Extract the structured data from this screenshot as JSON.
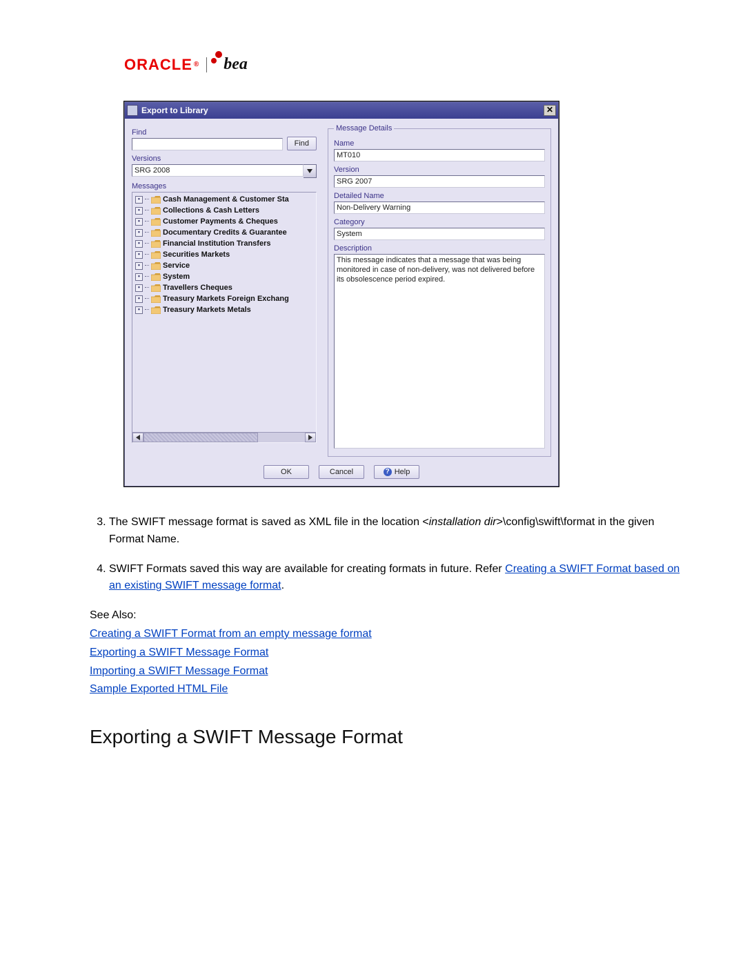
{
  "logos": {
    "oracle": "ORACLE",
    "reg": "®",
    "bea": "bea"
  },
  "dialog": {
    "title": "Export to Library",
    "find": {
      "label": "Find",
      "value": "",
      "buttonLabel": "Find"
    },
    "versions": {
      "label": "Versions",
      "selected": "SRG 2008"
    },
    "messages": {
      "label": "Messages",
      "items": [
        "Cash Management & Customer Sta",
        "Collections & Cash Letters",
        "Customer Payments & Cheques",
        "Documentary Credits & Guarantee",
        "Financial Institution Transfers",
        "Securities Markets",
        "Service",
        "System",
        "Travellers Cheques",
        "Treasury Markets Foreign Exchang",
        "Treasury Markets Metals"
      ]
    },
    "details": {
      "legend": "Message Details",
      "nameLabel": "Name",
      "nameValue": "MT010",
      "versionLabel": "Version",
      "versionValue": "SRG 2007",
      "detailedNameLabel": "Detailed Name",
      "detailedNameValue": "Non-Delivery Warning",
      "categoryLabel": "Category",
      "categoryValue": "System",
      "descriptionLabel": "Description",
      "descriptionValue": "This message indicates that a message that was being monitored in case of non-delivery, was not delivered before its obsolescence period expired."
    },
    "buttons": {
      "ok": "OK",
      "cancel": "Cancel",
      "help": "Help"
    }
  },
  "doc": {
    "li3a": "The SWIFT message format is saved as XML file in the location <",
    "li3_italic1": "installation dir",
    "li3b": ">\\config\\swift\\format in the given Format Name.",
    "li4a": "SWIFT Formats saved this way are available for creating formats in future. Refer ",
    "li4_link": "Creating a SWIFT Format based on an existing SWIFT message format",
    "li4b": ".",
    "see_also": "See Also:",
    "links": {
      "l1": "Creating a SWIFT Format from an empty message format",
      "l2": "Exporting a SWIFT Message Format",
      "l3": "Importing a SWIFT Message Format",
      "l4": "Sample Exported HTML File"
    },
    "heading": "Exporting a SWIFT Message Format"
  }
}
